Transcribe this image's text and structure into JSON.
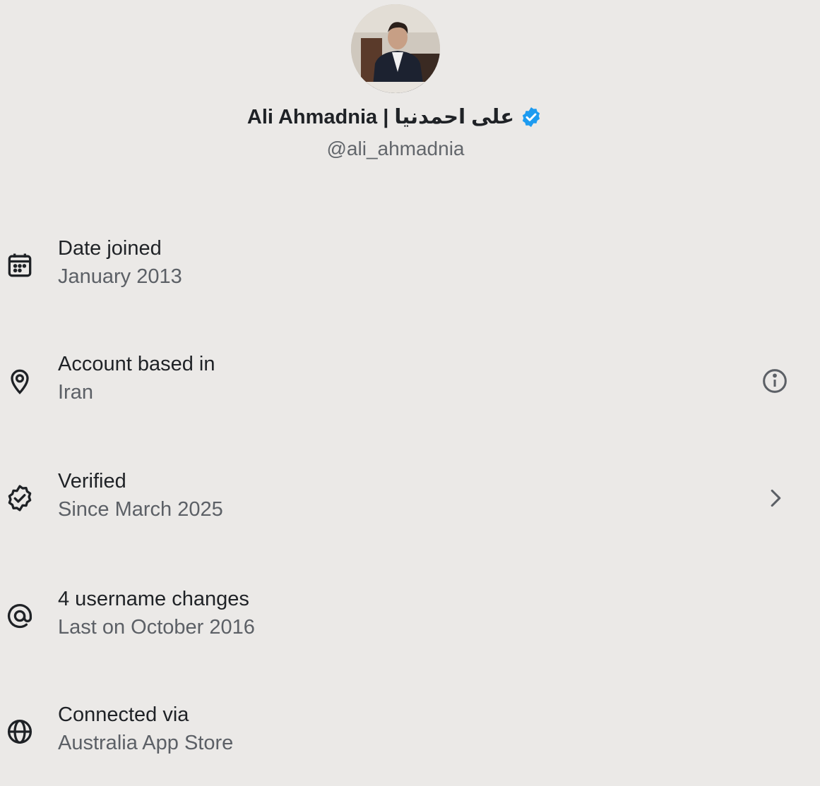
{
  "profile": {
    "display_name": "Ali Ahmadnia | علی احمدنیا",
    "handle": "@ali_ahmadnia",
    "avatar_icon": "profile-photo",
    "verified_icon": "verified-badge-icon",
    "verified_color": "#1d9bf0"
  },
  "details": [
    {
      "icon": "calendar-icon",
      "label": "Date joined",
      "value": "January 2013"
    },
    {
      "icon": "location-pin-icon",
      "label": "Account based in",
      "value": "Iran",
      "trailing_icon": "info-icon"
    },
    {
      "icon": "verified-outline-icon",
      "label": "Verified",
      "value": "Since March 2025",
      "trailing_icon": "chevron-right-icon"
    },
    {
      "icon": "at-sign-icon",
      "label": "4 username changes",
      "value": "Last on October 2016"
    },
    {
      "icon": "globe-icon",
      "label": "Connected via",
      "value": "Australia App Store"
    }
  ],
  "colors": {
    "background": "#ebe9e7",
    "primary_text": "#1f2226",
    "secondary_text": "#5c6066"
  }
}
